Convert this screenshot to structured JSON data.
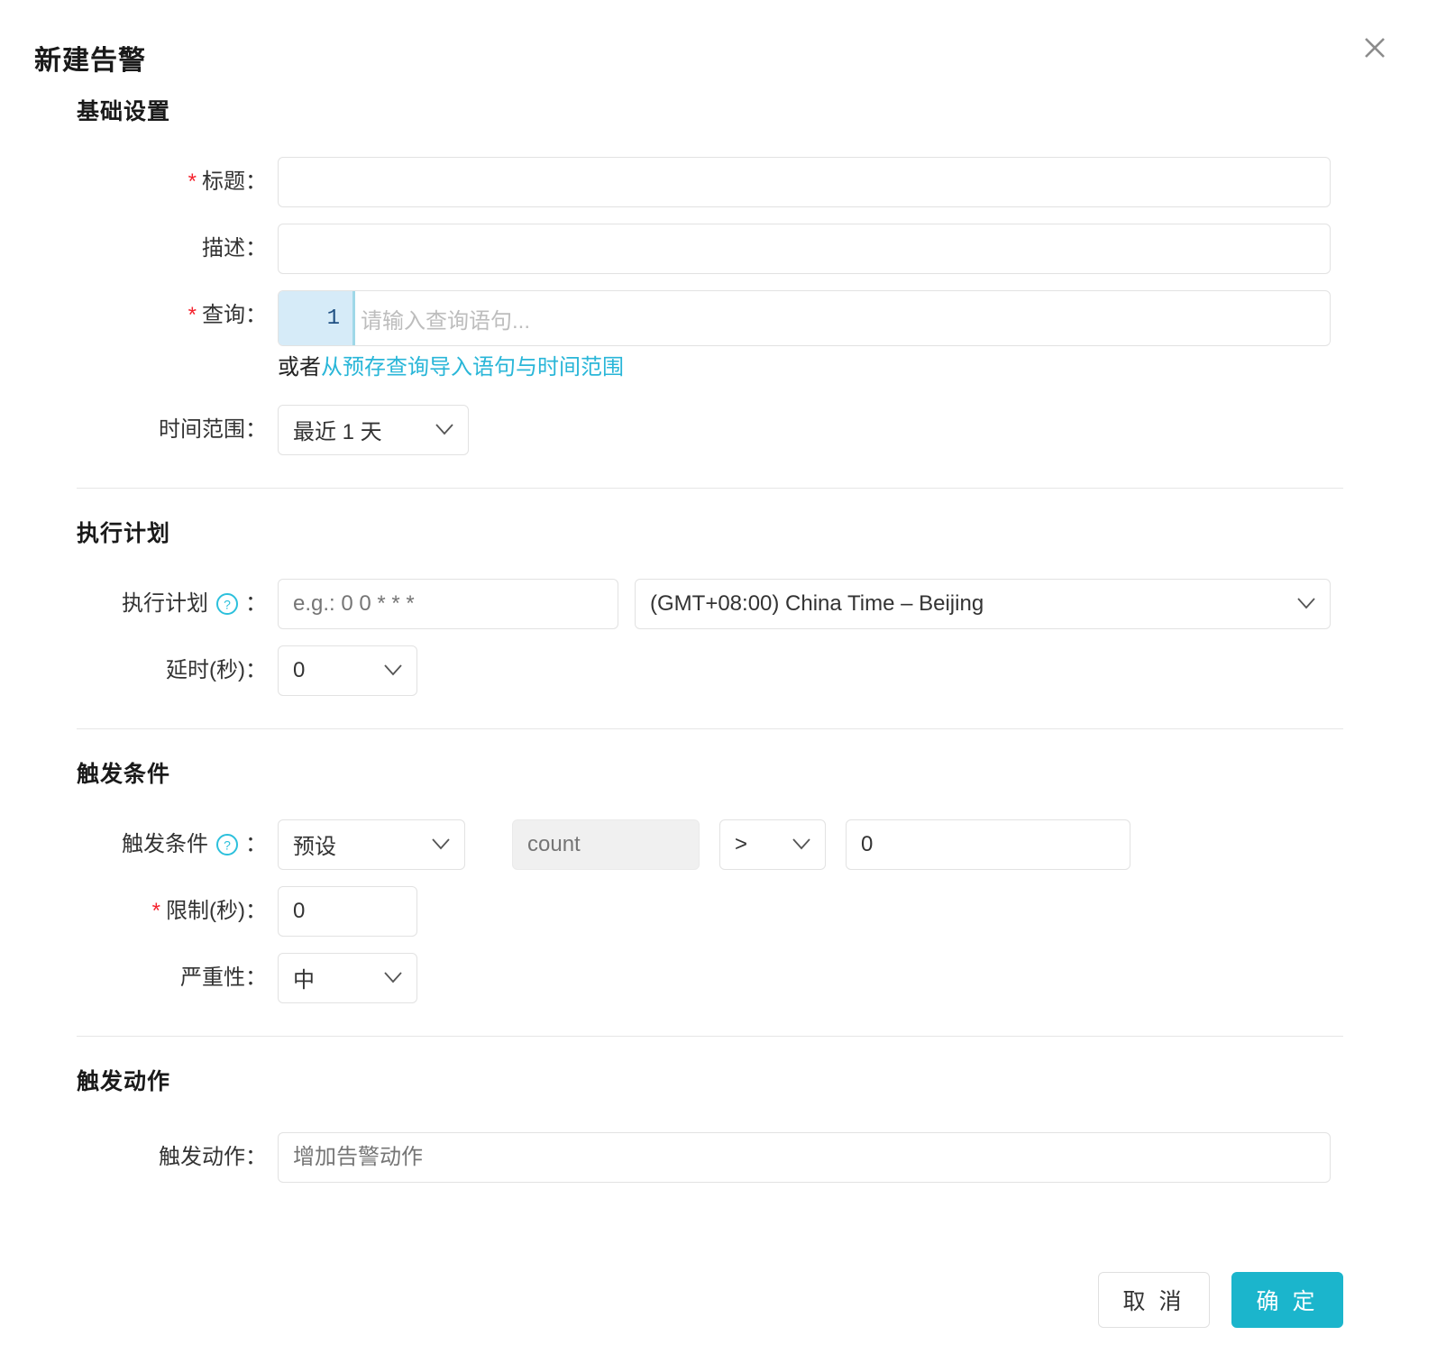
{
  "dialog": {
    "title": "新建告警",
    "close_icon": "close-icon"
  },
  "sections": {
    "basic": {
      "heading": "基础设置",
      "title_label": "标题：",
      "title_value": "",
      "title_required": "*",
      "desc_label": "描述：",
      "desc_value": "",
      "query_label": "查询：",
      "query_required": "*",
      "query_line_number": "1",
      "query_placeholder": "请输入查询语句...",
      "helper_prefix": "或者",
      "helper_link": "从预存查询导入语句与时间范围",
      "timerange_label": "时间范围：",
      "timerange_value": "最近 1 天"
    },
    "schedule": {
      "heading": "执行计划",
      "cron_label": "执行计划",
      "cron_colon": "：",
      "cron_placeholder": "e.g.: 0 0 * * *",
      "cron_value": "",
      "timezone_value": "(GMT+08:00) China Time – Beijing",
      "delay_label": "延时(秒)：",
      "delay_value": "0"
    },
    "trigger": {
      "heading": "触发条件",
      "condition_label": "触发条件",
      "condition_colon": "：",
      "mode_value": "预设",
      "count_placeholder": "count",
      "count_value": "",
      "operator_value": ">",
      "threshold_value": "0",
      "limit_label": "限制(秒)：",
      "limit_required": "*",
      "limit_value": "0",
      "severity_label": "严重性：",
      "severity_value": "中"
    },
    "action": {
      "heading": "触发动作",
      "action_label": "触发动作：",
      "action_placeholder": "增加告警动作",
      "action_value": ""
    }
  },
  "footer": {
    "cancel_label": "取 消",
    "confirm_label": "确 定"
  },
  "colors": {
    "accent": "#1bb5cc",
    "link": "#29b6d8",
    "required": "#f5222d",
    "gutter_bg": "#d6ebf8",
    "gutter_fg": "#1f4f82",
    "border": "#e2e2e2",
    "divider": "#e6e6e6",
    "disabled_bg": "#f0f0f0"
  },
  "icons": {
    "close": "close-icon",
    "help": "help-circle-icon",
    "chevron_down": "chevron-down-icon"
  }
}
